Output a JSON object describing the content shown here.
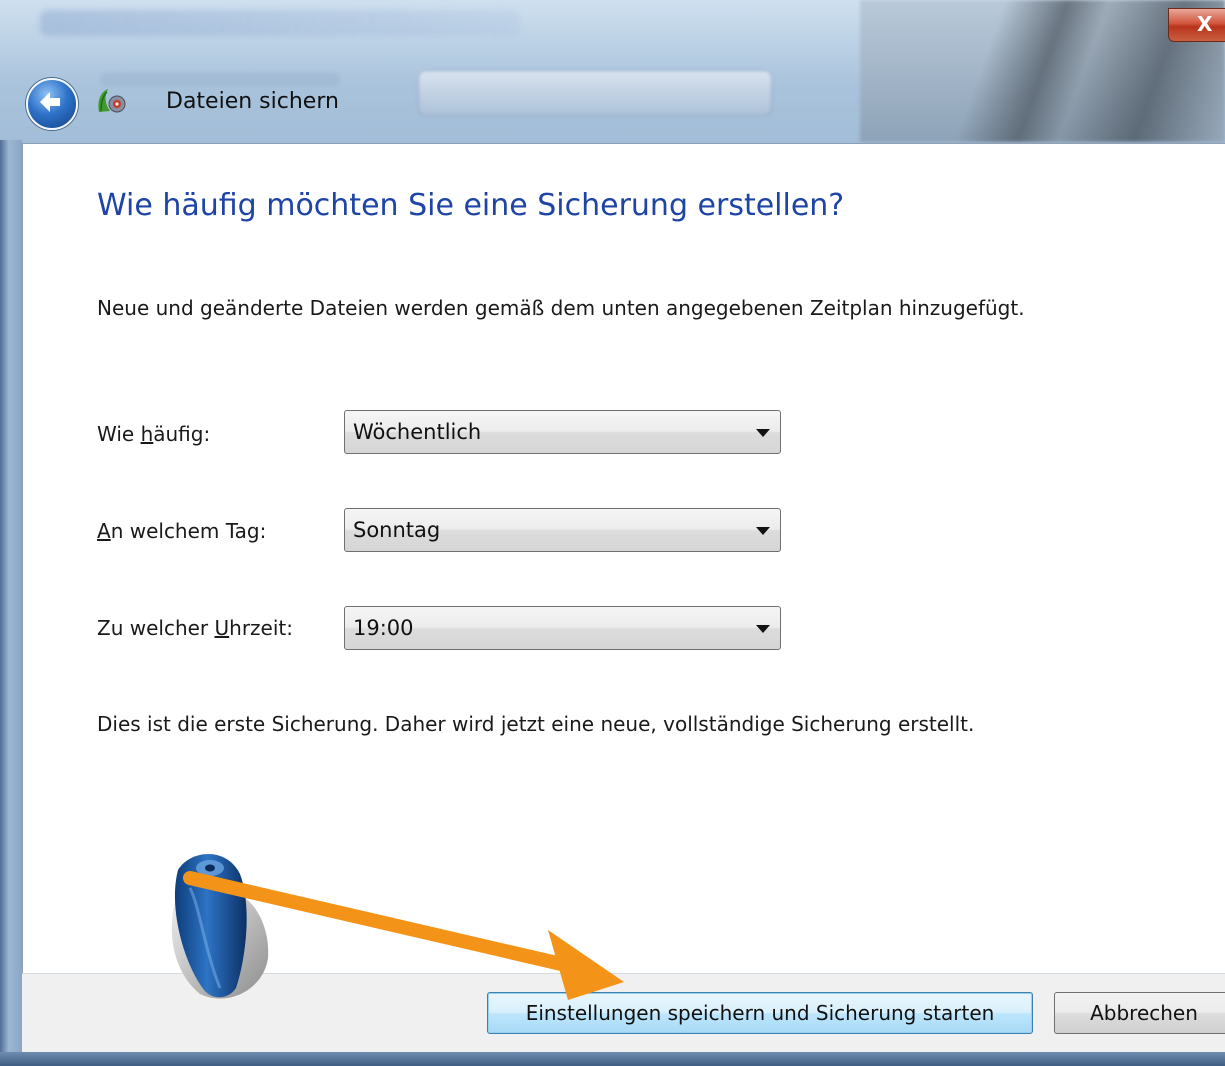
{
  "window": {
    "close_glyph": "X",
    "header_title": "Dateien sichern"
  },
  "page": {
    "heading": "Wie häufig möchten Sie eine Sicherung erstellen?",
    "intro": "Neue und geänderte Dateien werden gemäß dem unten angegebenen Zeitplan hinzugefügt.",
    "fields": [
      {
        "label_pre": "Wie ",
        "label_access": "h",
        "label_post": "äufig:",
        "value": "Wöchentlich"
      },
      {
        "label_pre": "",
        "label_access": "A",
        "label_post": "n welchem Tag:",
        "value": "Sonntag"
      },
      {
        "label_pre": "Zu welcher ",
        "label_access": "U",
        "label_post": "hrzeit:",
        "value": "19:00"
      }
    ],
    "note": "Dies ist die erste Sicherung. Daher wird jetzt eine neue, vollständige Sicherung erstellt."
  },
  "footer": {
    "save_label": "Einstellungen speichern und Sicherung starten",
    "cancel_label": "Abbrechen"
  },
  "colors": {
    "heading": "#1e44a6",
    "arrow": "#f39317",
    "mouse": "#1c5aa8"
  },
  "icons": {
    "back": "back-arrow-icon",
    "app": "backup-app-icon",
    "pointer": "mouse-illustration"
  }
}
